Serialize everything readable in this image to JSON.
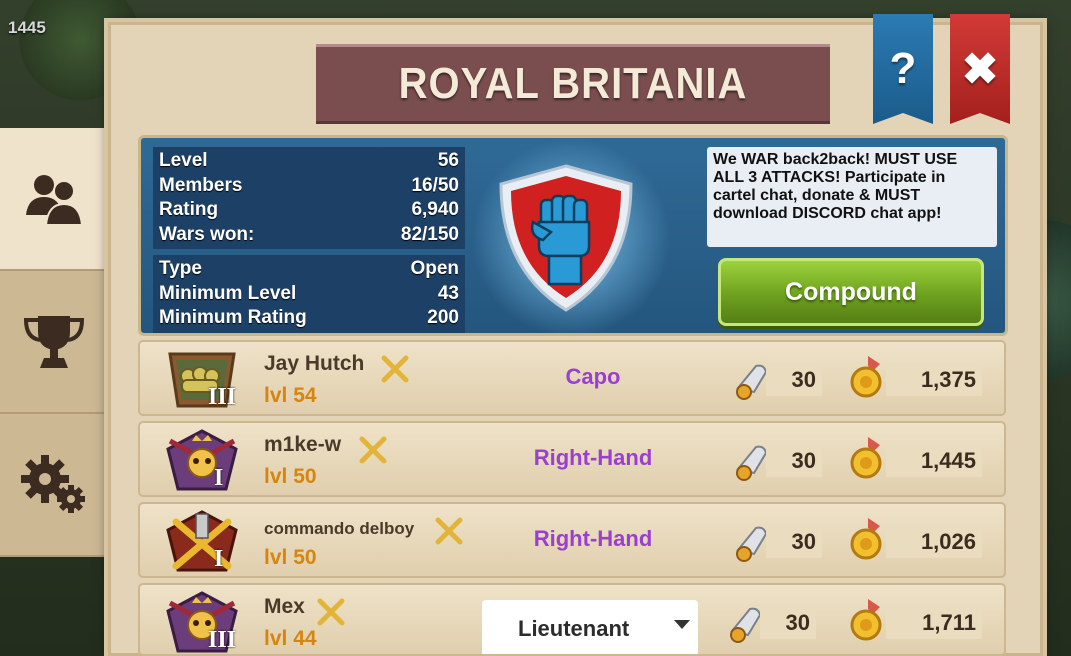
{
  "corner_counter": "1445",
  "title": "ROYAL BRITANIA",
  "header_buttons": {
    "help": "?",
    "close": "✖"
  },
  "sidebar": [
    {
      "icon": "members-icon",
      "active": true
    },
    {
      "icon": "trophy-icon",
      "active": false
    },
    {
      "icon": "settings-icon",
      "active": false
    }
  ],
  "stats_group_1": [
    {
      "label": "Level",
      "value": "56"
    },
    {
      "label": "Members",
      "value": "16/50"
    },
    {
      "label": "Rating",
      "value": "6,940"
    },
    {
      "label": "Wars won:",
      "value": "82/150"
    }
  ],
  "stats_group_2": [
    {
      "label": "Type",
      "value": "Open"
    },
    {
      "label": "Minimum Level",
      "value": "43"
    },
    {
      "label": "Minimum Rating",
      "value": "200"
    }
  ],
  "emblem": {
    "icon": "raised-fist-icon",
    "shield_color": "#d0201f",
    "fist_color": "#2a9ad6"
  },
  "message": "We WAR back2back! MUST USE ALL 3 ATTACKS!  Participate in cartel chat, donate & MUST download DISCORD chat app!",
  "compound_button": "Compound",
  "members": [
    {
      "name": "Jay Hutch",
      "level_prefix": "lvl",
      "level": "54",
      "rank_numeral": "III",
      "role": "Capo",
      "attacks": "30",
      "donated": "1,375"
    },
    {
      "name": "m1ke-w",
      "level_prefix": "lvl",
      "level": "50",
      "rank_numeral": "I",
      "role": "Right-Hand",
      "attacks": "30",
      "donated": "1,445"
    },
    {
      "name": "commando delboy",
      "level_prefix": "lvl",
      "level": "50",
      "rank_numeral": "I",
      "role": "Right-Hand",
      "attacks": "30",
      "donated": "1,026"
    },
    {
      "name": "Mex",
      "level_prefix": "lvl",
      "level": "44",
      "rank_numeral": "III",
      "role": "Lieutenant",
      "attacks": "30",
      "donated": "1,711"
    }
  ],
  "colors": {
    "role": "#9a3fd1",
    "level": "#d6860f",
    "banner": "#7a4e4f",
    "info_bg": "#2f6a96",
    "compound": "#7db52a",
    "help_ribbon": "#2b7bb3",
    "close_ribbon": "#d23a36"
  }
}
